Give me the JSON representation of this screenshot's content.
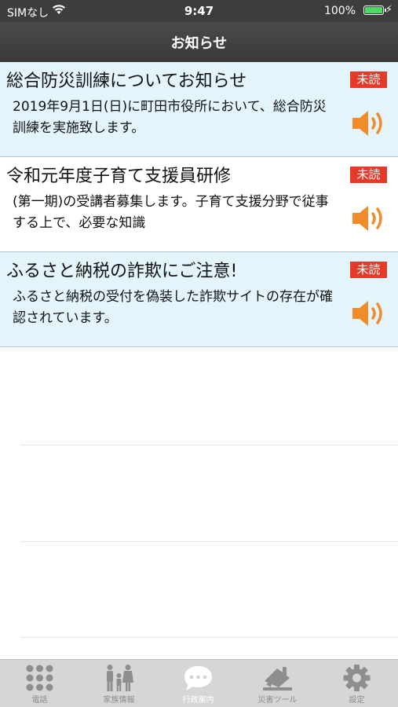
{
  "status_bar": {
    "carrier": "SIMなし",
    "time": "9:47",
    "battery_percent": "100%",
    "battery_level": 1.0
  },
  "nav": {
    "title": "お知らせ"
  },
  "notices": [
    {
      "title": "総合防災訓練についてお知らせ",
      "body": "2019年9月1日(日)に町田市役所において、総合防災訓練を実施致します。",
      "badge": "未読",
      "state": "unread"
    },
    {
      "title": "令和元年度子育て支援員研修",
      "body": "(第一期)の受講者募集します。子育て支援分野で従事する上で、必要な知識",
      "badge": "未読",
      "state": "read"
    },
    {
      "title": "ふるさと納税の詐欺にご注意!",
      "body": "ふるさと納税の受付を偽装した詐欺サイトの存在が確認されています。",
      "badge": "未読",
      "state": "unread"
    }
  ],
  "tabs": [
    {
      "label": "電話",
      "icon": "keypad-icon",
      "active": false
    },
    {
      "label": "家族情報",
      "icon": "family-icon",
      "active": false
    },
    {
      "label": "行政案内",
      "icon": "chat-bubble-icon",
      "active": true
    },
    {
      "label": "災害ツール",
      "icon": "collapsed-house-icon",
      "active": false
    },
    {
      "label": "設定",
      "icon": "gear-icon",
      "active": false
    }
  ],
  "colors": {
    "unread_bg": "#e3f5fb",
    "badge_red": "#e33a2a",
    "speaker_orange": "#f08c2a",
    "nav_bg": "#3d3d3d",
    "tab_bg": "#d6d6d6",
    "tab_icon": "#8e8e8e"
  }
}
